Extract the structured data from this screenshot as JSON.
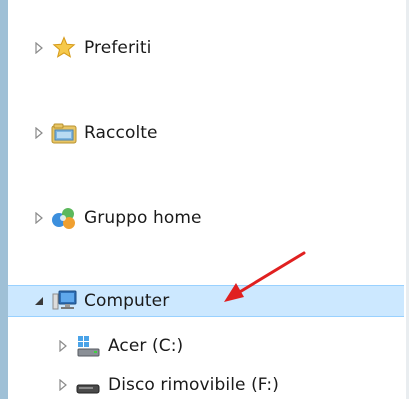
{
  "tree": {
    "favorites": {
      "label": "Preferiti"
    },
    "libraries": {
      "label": "Raccolte"
    },
    "homegroup": {
      "label": "Gruppo home"
    },
    "computer": {
      "label": "Computer"
    },
    "drive_c": {
      "label": "Acer (C:)"
    },
    "drive_f": {
      "label": "Disco rimovibile (F:)"
    }
  },
  "colors": {
    "selection_fill": "#cce8ff",
    "selection_border": "#99d1ff",
    "annotation_arrow": "#e02020"
  }
}
